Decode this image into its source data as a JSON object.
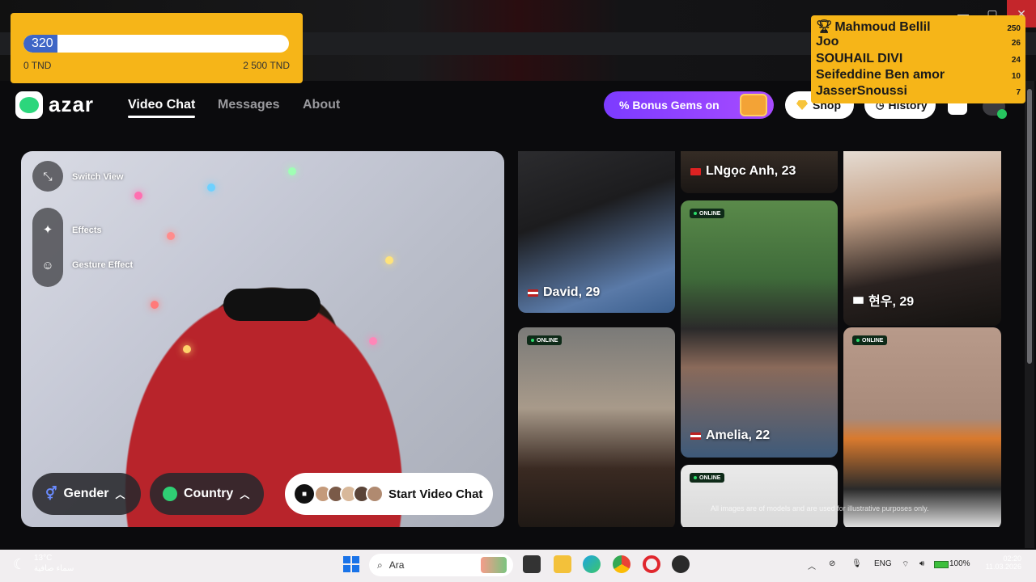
{
  "window": {
    "minimize": "—",
    "maximize": "▢",
    "close": "✕"
  },
  "donation": {
    "current": "320",
    "progress": 0.128,
    "min_label": "0 TND",
    "max_label": "2 500 TND",
    "bar_color": "#3e66c6",
    "bg_color": "#f6b518"
  },
  "leaderboard": [
    {
      "name": "Mahmoud Bellil",
      "score": "250"
    },
    {
      "name": "Joo",
      "score": "26"
    },
    {
      "name": "SOUHAIL DIVI",
      "score": "24"
    },
    {
      "name": "Seifeddine Ben amor",
      "score": "10"
    },
    {
      "name": "JasserSnoussi",
      "score": "7"
    }
  ],
  "header": {
    "logo": "azar",
    "nav": [
      {
        "label": "Video Chat"
      },
      {
        "label": "Messages"
      },
      {
        "label": "About"
      }
    ],
    "bonus": "% Bonus Gems on",
    "shop": "Shop",
    "history": "History"
  },
  "video": {
    "tools": {
      "switch_view": "Switch View",
      "effects": "Effects",
      "gesture": "Gesture Effect"
    },
    "gender": "Gender",
    "country": "Country",
    "start": "Start Video Chat"
  },
  "gallery": {
    "cards": [
      {
        "name": "David, 29",
        "flag": "us"
      },
      {
        "name": "LNgọc Anh, 23",
        "flag": "vn"
      },
      {
        "name": "현우, 29",
        "flag": "kr"
      },
      {
        "name": "Amelia, 22",
        "flag": "us",
        "online": "ONLINE"
      },
      {
        "online": "ONLINE"
      },
      {
        "online": "ONLINE"
      },
      {
        "online": "ONLINE"
      }
    ],
    "disclaimer": "All images are of models and are used for illustrative purposes only."
  },
  "taskbar": {
    "temp": "13°C",
    "condition": "سماء صافية",
    "search_placeholder": "Ara",
    "lang": "ENG",
    "battery": "100%",
    "time": "02:20",
    "date": "11.03.2026"
  },
  "icons": {
    "trophy": "trophy-icon",
    "gem": "gem-icon",
    "camera": "camera-icon",
    "search": "search-icon"
  }
}
